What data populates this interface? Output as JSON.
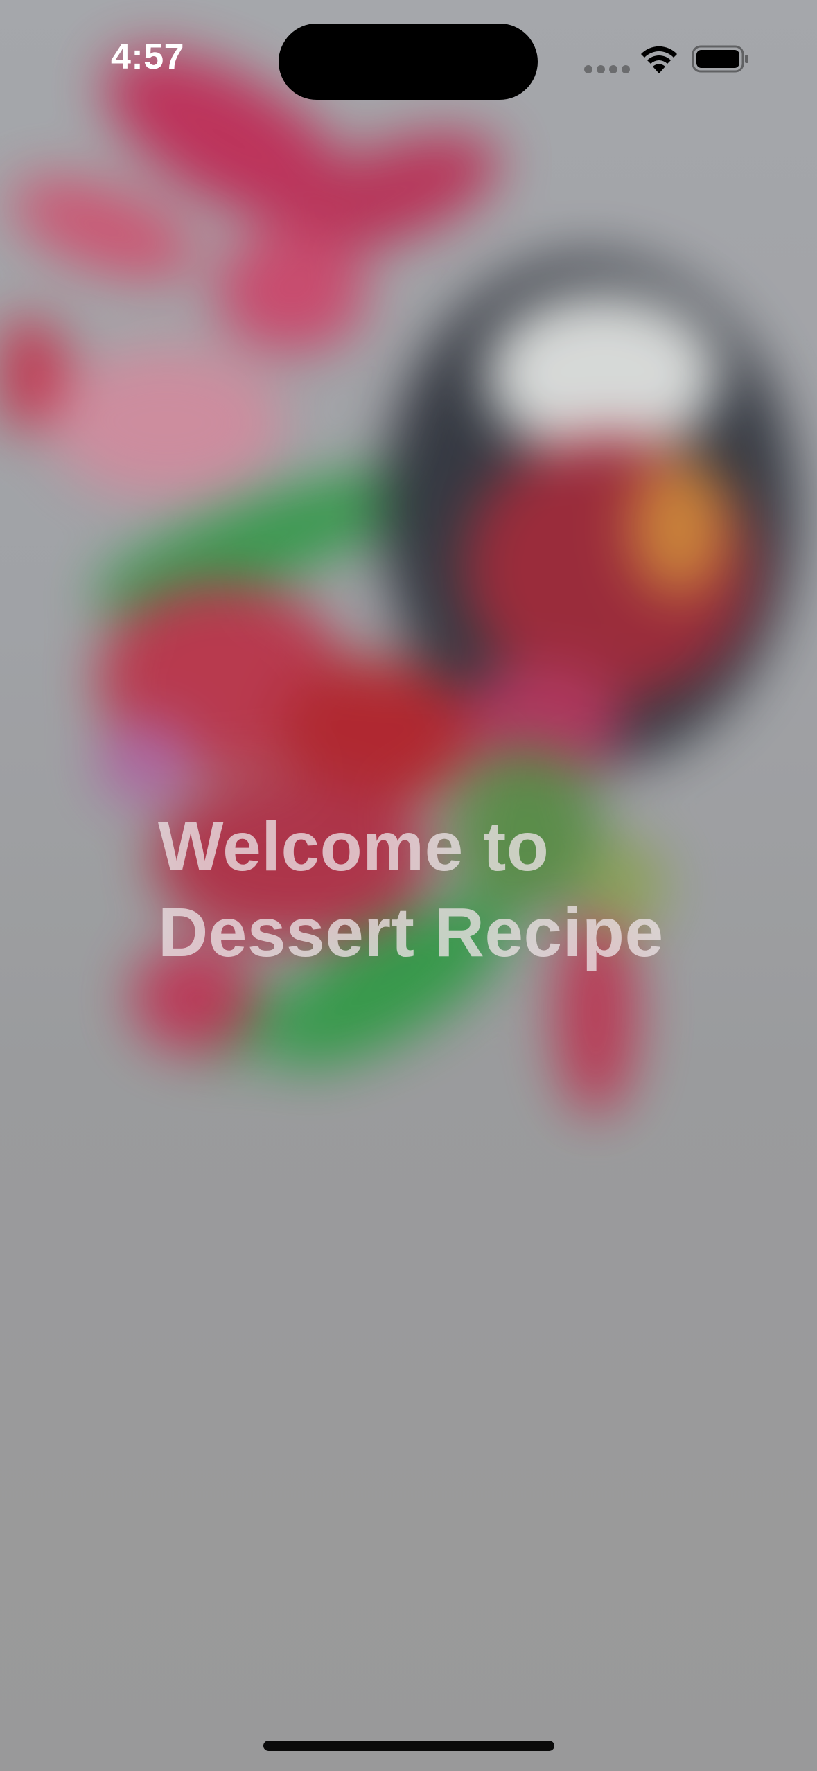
{
  "status_bar": {
    "time": "4:57"
  },
  "welcome": {
    "line1": "Welcome to",
    "line2": "Dessert Recipe"
  },
  "colors": {
    "background": "#9c9da0",
    "accent_red": "#c8102e",
    "accent_green": "#1f9a3a",
    "text": "#ebe1e4"
  },
  "icons": [
    "signal-icon",
    "wifi-icon",
    "battery-icon"
  ]
}
